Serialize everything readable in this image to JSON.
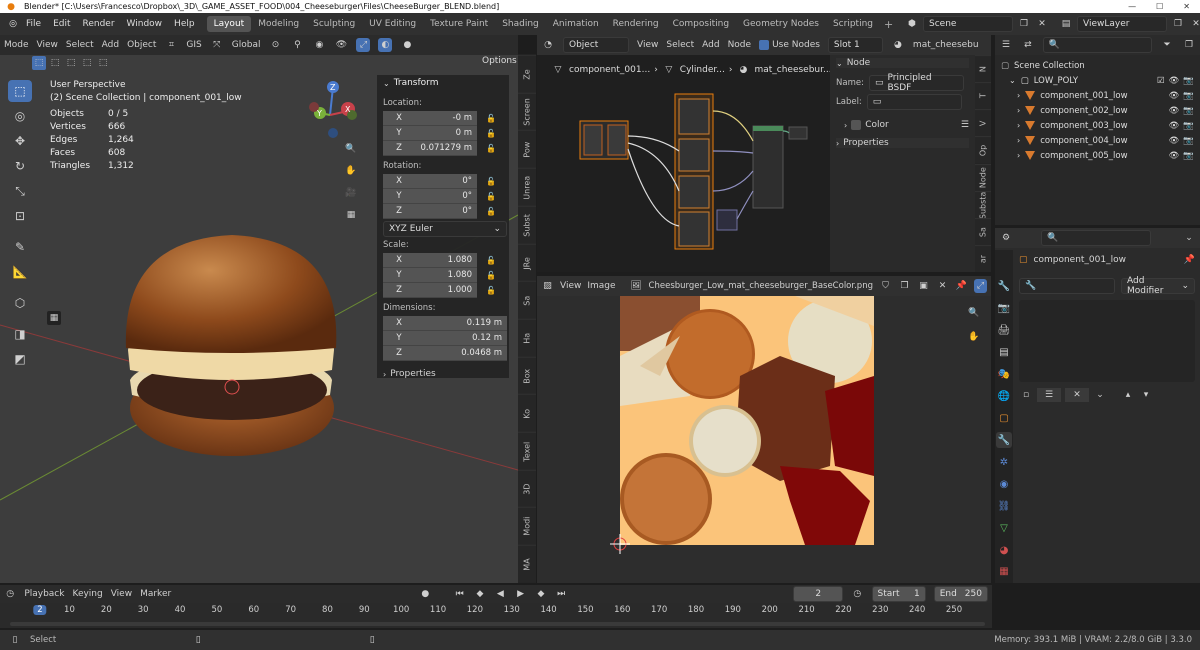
{
  "titlebar": {
    "text": "Blender* [C:\\Users\\Francesco\\Dropbox\\_3D\\_GAME_ASSET_FOOD\\004_Cheeseburger\\Files\\CheeseBurger_BLEND.blend]"
  },
  "menu": [
    "File",
    "Edit",
    "Render",
    "Window",
    "Help"
  ],
  "workspaces": [
    {
      "label": "Layout",
      "active": true
    },
    {
      "label": "Modeling"
    },
    {
      "label": "Sculpting"
    },
    {
      "label": "UV Editing"
    },
    {
      "label": "Texture Paint"
    },
    {
      "label": "Shading"
    },
    {
      "label": "Animation"
    },
    {
      "label": "Rendering"
    },
    {
      "label": "Compositing"
    },
    {
      "label": "Geometry Nodes"
    },
    {
      "label": "Scripting"
    }
  ],
  "scene": {
    "label": "Scene",
    "viewlayer": "ViewLayer"
  },
  "viewport_header": {
    "mode": "Mode",
    "view": "View",
    "select": "Select",
    "add": "Add",
    "object": "Object",
    "gis": "GIS",
    "orientation": "Global",
    "options": "Options"
  },
  "viewport": {
    "perspective": "User Perspective",
    "collection": "(2) Scene Collection | component_001_low",
    "stats": [
      {
        "label": "Objects",
        "value": "0 / 5"
      },
      {
        "label": "Vertices",
        "value": "666"
      },
      {
        "label": "Edges",
        "value": "1,264"
      },
      {
        "label": "Faces",
        "value": "608"
      },
      {
        "label": "Triangles",
        "value": "1,312"
      }
    ]
  },
  "transform": {
    "title": "Transform",
    "location_label": "Location:",
    "location": [
      {
        "axis": "X",
        "value": "-0 m"
      },
      {
        "axis": "Y",
        "value": "0 m"
      },
      {
        "axis": "Z",
        "value": "0.071279 m"
      }
    ],
    "rotation_label": "Rotation:",
    "rotation": [
      {
        "axis": "X",
        "value": "0°"
      },
      {
        "axis": "Y",
        "value": "0°"
      },
      {
        "axis": "Z",
        "value": "0°"
      }
    ],
    "rotation_mode": "XYZ Euler",
    "scale_label": "Scale:",
    "scale": [
      {
        "axis": "X",
        "value": "1.080"
      },
      {
        "axis": "Y",
        "value": "1.080"
      },
      {
        "axis": "Z",
        "value": "1.000"
      }
    ],
    "dimensions_label": "Dimensions:",
    "dimensions": [
      {
        "axis": "X",
        "value": "0.119 m"
      },
      {
        "axis": "Y",
        "value": "0.12 m"
      },
      {
        "axis": "Z",
        "value": "0.0468 m"
      }
    ],
    "properties": "Properties"
  },
  "viewport_tabs": [
    "Ze",
    "Screen",
    "Pow",
    "Unrea",
    "Subst",
    "JRe",
    "Sa",
    "Ha",
    "Box",
    "Ko",
    "Texel",
    "3D",
    "Modi",
    "MA"
  ],
  "node_editor": {
    "object": "Object",
    "view": "View",
    "select": "Select",
    "add": "Add",
    "node": "Node",
    "use_nodes": "Use Nodes",
    "slot": "Slot 1",
    "material": "mat_cheesebu",
    "breadcrumb": [
      "component_001...",
      "Cylinder...",
      "mat_cheesebur..."
    ]
  },
  "node_panel": {
    "title": "Node",
    "name_label": "Name:",
    "name_value": "Principled BSDF",
    "label_label": "Label:",
    "color": "Color",
    "properties": "Properties"
  },
  "node_tabs": [
    "N",
    "T",
    "V",
    "Op",
    "Node",
    "Substa",
    "Sa",
    "ar"
  ],
  "image_editor": {
    "view": "View",
    "image": "Image",
    "filename": "Cheesburger_Low_mat_cheeseburger_BaseColor.png"
  },
  "outliner": {
    "root": "Scene Collection",
    "collection": "LOW_POLY",
    "items": [
      "component_001_low",
      "component_002_low",
      "component_003_low",
      "component_004_low",
      "component_005_low"
    ]
  },
  "properties": {
    "object": "component_001_low",
    "add_modifier": "Add Modifier"
  },
  "timeline": {
    "playback": "Playback",
    "keying": "Keying",
    "view": "View",
    "marker": "Marker",
    "current_frame": "2",
    "start_label": "Start",
    "start": "1",
    "end_label": "End",
    "end": "250",
    "ticks": [
      "2",
      "10",
      "20",
      "30",
      "40",
      "50",
      "60",
      "70",
      "80",
      "90",
      "100",
      "110",
      "120",
      "130",
      "140",
      "150",
      "160",
      "170",
      "180",
      "190",
      "200",
      "210",
      "220",
      "230",
      "240",
      "250"
    ]
  },
  "statusbar": {
    "select": "Select",
    "memory": "Memory: 393.1 MiB | VRAM: 2.2/8.0 GiB | 3.3.0"
  }
}
